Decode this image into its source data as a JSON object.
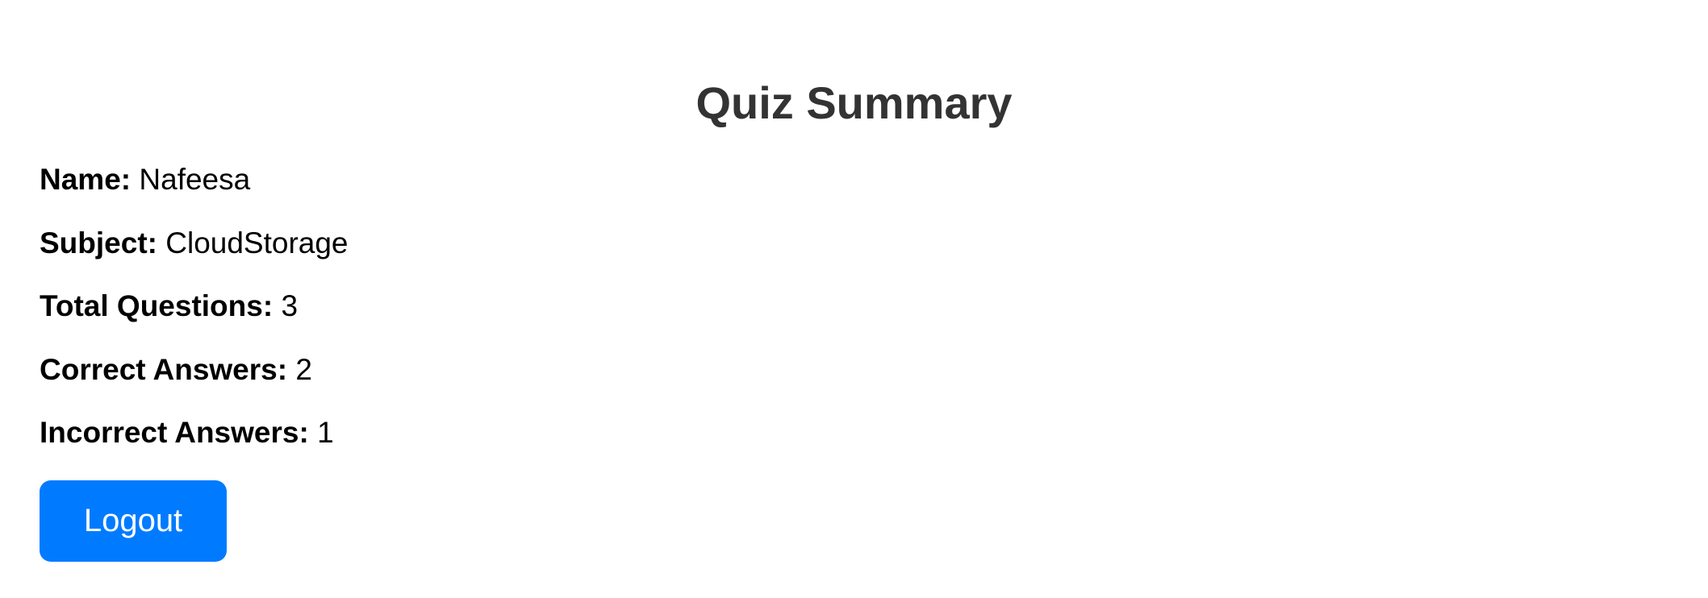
{
  "page": {
    "title": "Quiz Summary"
  },
  "summary": {
    "name": {
      "label": "Name:",
      "value": "Nafeesa"
    },
    "subject": {
      "label": "Subject:",
      "value": "CloudStorage"
    },
    "total_questions": {
      "label": "Total Questions:",
      "value": "3"
    },
    "correct_answers": {
      "label": "Correct Answers:",
      "value": "2"
    },
    "incorrect_answers": {
      "label": "Incorrect Answers:",
      "value": "1"
    }
  },
  "actions": {
    "logout_label": "Logout"
  },
  "colors": {
    "button_bg": "#007bff",
    "button_text": "#ffffff",
    "title_text": "#333333"
  }
}
